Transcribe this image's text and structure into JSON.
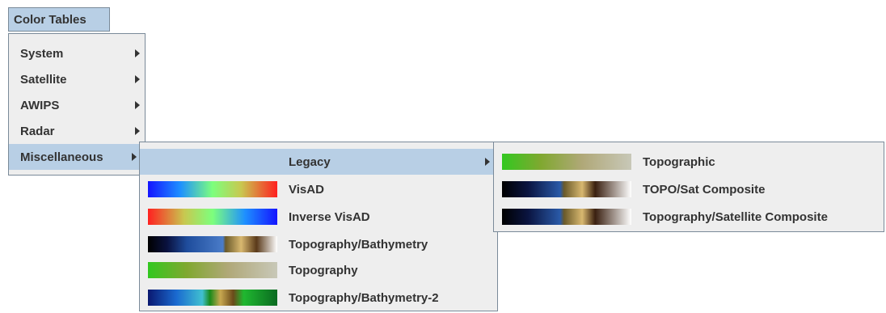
{
  "menubar": {
    "title": "Color Tables"
  },
  "main_menu": {
    "items": [
      {
        "label": "System"
      },
      {
        "label": "Satellite"
      },
      {
        "label": "AWIPS"
      },
      {
        "label": "Radar"
      },
      {
        "label": "Miscellaneous"
      }
    ]
  },
  "misc_menu": {
    "legacy_label": "Legacy",
    "items": [
      {
        "label": "VisAD",
        "gradient": "linear-gradient(to right,#1414ff 0%,#1e90ff 25%,#7dff7d 50%,#c8c850 72%,#ff2020 100%)"
      },
      {
        "label": "Inverse VisAD",
        "gradient": "linear-gradient(to right,#ff2020 0%,#c8c850 28%,#7dff7d 50%,#1e90ff 75%,#1414ff 100%)"
      },
      {
        "label": "Topography/Bathymetry",
        "gradient": "linear-gradient(to right,#000000 0%,#0a1240 15%,#1e4c9c 30%,#4a7cc8 58%,#6a5a2a 60%,#d8b870 72%,#5a3a1a 84%,#ffffff 100%)"
      },
      {
        "label": "Topography",
        "gradient": "linear-gradient(to right,#32c820 0%,#80a830 30%,#b0a878 62%,#c8c8b8 100%)"
      },
      {
        "label": "Topography/Bathymetry-2",
        "gradient": "linear-gradient(to right,#0a1870 0%,#1a6ad0 22%,#40c0d0 42%,#1a8a1a 48%,#c8a850 56%,#6a4a1a 66%,#20b830 74%,#0a6a20 100%)"
      }
    ]
  },
  "legacy_menu": {
    "items": [
      {
        "label": "Topographic",
        "gradient": "linear-gradient(to right,#32c820 0%,#80a830 30%,#b0a878 62%,#c8c8b8 100%)"
      },
      {
        "label": "TOPO/Sat Composite",
        "gradient": "linear-gradient(to right,#000000 0%,#0a1440 20%,#2a5aa8 45%,#6a5a2a 48%,#d8b870 62%,#3a2010 72%,#ffffff 100%)"
      },
      {
        "label": "Topography/Satellite Composite",
        "gradient": "linear-gradient(to right,#000000 0%,#0a1440 20%,#2a5aa8 45%,#6a5a2a 48%,#d8b870 62%,#3a2010 72%,#ffffff 100%)"
      }
    ]
  },
  "colors": {
    "selection": "#b8cfe5",
    "menu_bg": "#eeeeee",
    "border": "#7a8a99"
  }
}
